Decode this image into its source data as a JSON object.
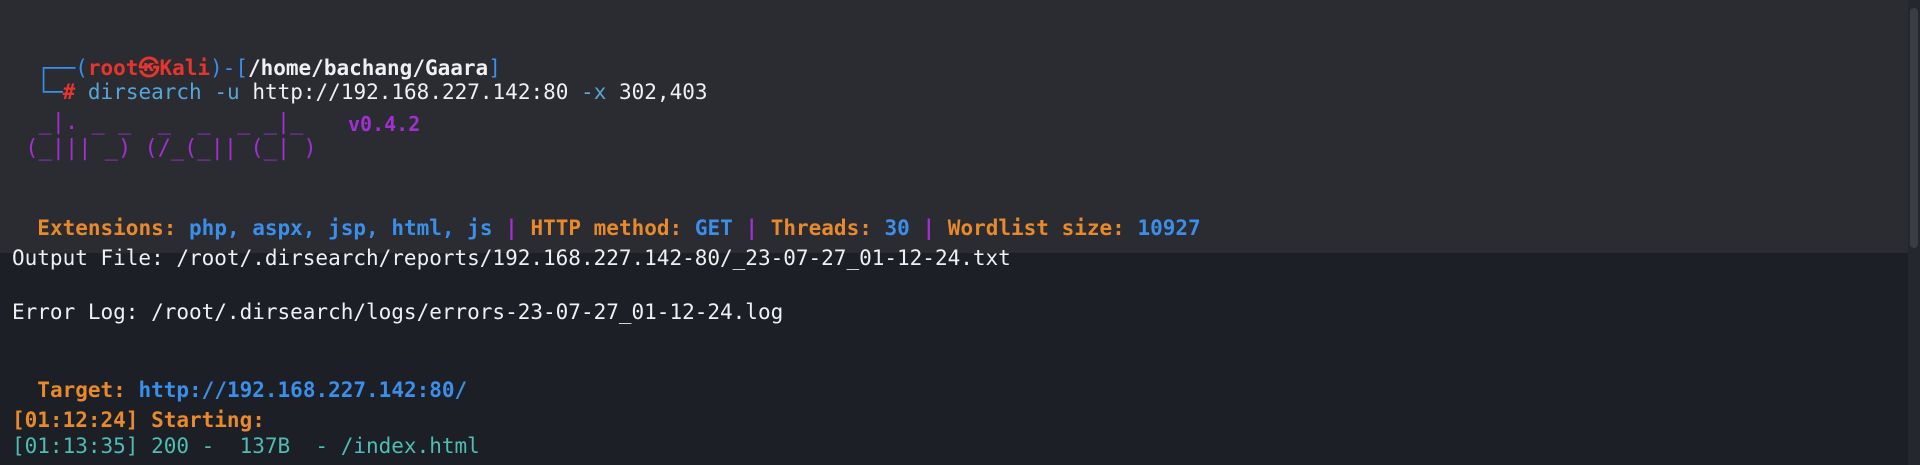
{
  "prompt": {
    "open": "┌──(",
    "user": "root㉿Kali",
    "mid": ")-[",
    "path": "/home/bachang/Gaara",
    "close": "]",
    "hash_prefix": "└─",
    "hash": "#",
    "cmd": "dirsearch",
    "flag_u": "-u",
    "url": "http://192.168.227.142:80",
    "flag_x": "-x",
    "codes": "302,403"
  },
  "banner": {
    "art_line1": "  _|. _ _  _  _  _ _|_",
    "art_line2": " (_||| _) (/_(_|| (_| )",
    "version": "v0.4.2"
  },
  "config": {
    "ext_label": "Extensions:",
    "ext_value": "php, aspx, jsp, html, js",
    "sep1": "|",
    "method_label": "HTTP method:",
    "method_value": "GET",
    "sep2": "|",
    "threads_label": "Threads:",
    "threads_value": "30",
    "sep3": "|",
    "wordlist_label": "Wordlist size:",
    "wordlist_value": "10927"
  },
  "output_file": "Output File: /root/.dirsearch/reports/192.168.227.142-80/_23-07-27_01-12-24.txt",
  "error_log": "Error Log: /root/.dirsearch/logs/errors-23-07-27_01-12-24.log",
  "target": {
    "label": "Target:",
    "value": "http://192.168.227.142:80/"
  },
  "start": "[01:12:24] Starting:",
  "result": "[01:13:35] 200 -  137B  - /index.html"
}
